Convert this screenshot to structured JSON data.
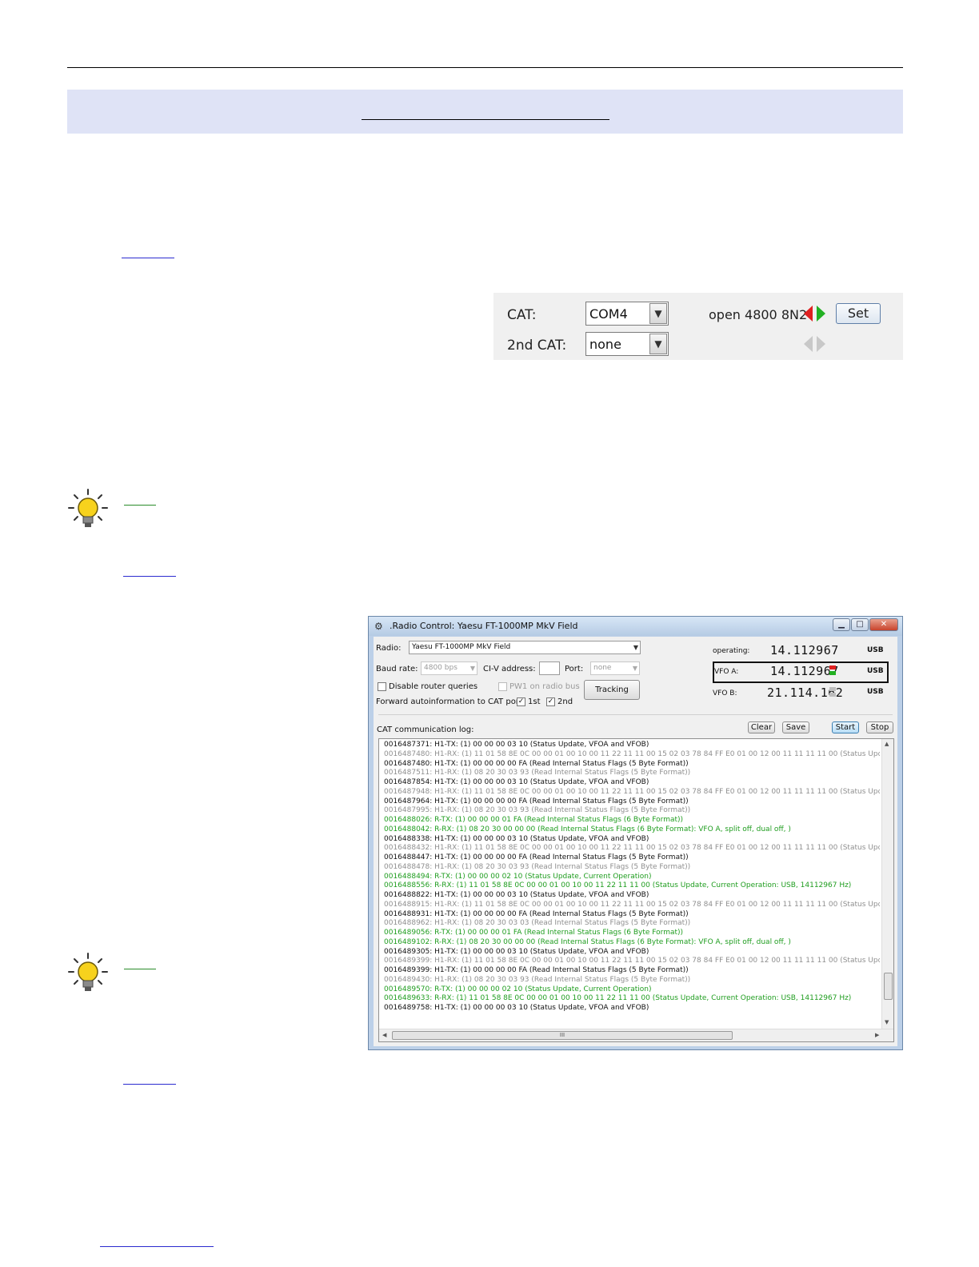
{
  "cat_panel": {
    "cat_label": "CAT:",
    "cat_port": "COM4",
    "second_cat_label": "2nd CAT:",
    "second_cat_port": "none",
    "status_text": "open 4800 8N2",
    "set_label": "Set",
    "colors": {
      "tx_indicator": "#e02020",
      "rx_indicator": "#22b022",
      "inactive_indicator": "#c8c8c8"
    }
  },
  "window": {
    "title": ".Radio Control: Yaesu FT-1000MP MkV Field",
    "radio_label": "Radio:",
    "radio_value": "Yaesu FT-1000MP MkV Field",
    "baud_label": "Baud rate:",
    "baud_value": "4800 bps",
    "civ_label": "CI-V address:",
    "civ_value": "",
    "port_label": "Port:",
    "port_value": "none",
    "disable_router_label": "Disable router queries",
    "pw1_label": "PW1 on radio bus",
    "tracking_label": "Tracking",
    "forward_label": "Forward autoinformation to CAT port:",
    "forward_1st_label": "1st",
    "forward_1st_checked": true,
    "forward_2nd_label": "2nd",
    "forward_2nd_checked": true,
    "operating_label": "operating:",
    "operating_freq": "14.112967",
    "operating_mode": "USB",
    "vfoa_label": "VFO A:",
    "vfoa_freq": "14.112967",
    "vfoa_mode": "USB",
    "vfob_label": "VFO B:",
    "vfob_freq": "21.114.162",
    "vfob_mode": "USB",
    "log_label": "CAT communication log:",
    "clear_label": "Clear",
    "save_label": "Save",
    "start_label": "Start",
    "stop_label": "Stop",
    "hscroll_grip": "III",
    "colors": {
      "tx_line": "#111111",
      "rx_line": "#8f8f8f",
      "secondary_line": "#1f9d1f"
    },
    "log": [
      {
        "kind": "tx",
        "text": "0016487371:  H1-TX: (1) 00 00 00 03 10   (Status Update, VFOA and VFOB)"
      },
      {
        "kind": "rx",
        "text": "0016487480:  H1-RX: (1) 11 01 58 8E 0C 00 00 01 00 10 00 11 22 11 11 00 15 02 03 78 84 FF E0 01 00 12 00 11 11 11 11 00   (Status Update, V"
      },
      {
        "kind": "tx",
        "text": "0016487480:  H1-TX: (1) 00 00 00 00 FA   (Read Internal Status Flags (5 Byte Format))"
      },
      {
        "kind": "rx",
        "text": "0016487511:  H1-RX: (1) 08 20 30 03 93   (Read Internal Status Flags (5 Byte Format))"
      },
      {
        "kind": "tx",
        "text": "0016487854:  H1-TX: (1) 00 00 00 03 10   (Status Update, VFOA and VFOB)"
      },
      {
        "kind": "rx",
        "text": "0016487948:  H1-RX: (1) 11 01 58 8E 0C 00 00 01 00 10 00 11 22 11 11 00 15 02 03 78 84 FF E0 01 00 12 00 11 11 11 11 00   (Status Update, V"
      },
      {
        "kind": "tx",
        "text": "0016487964:  H1-TX: (1) 00 00 00 00 FA   (Read Internal Status Flags (5 Byte Format))"
      },
      {
        "kind": "rx",
        "text": "0016487995:  H1-RX: (1) 08 20 30 03 93   (Read Internal Status Flags (5 Byte Format))"
      },
      {
        "kind": "green",
        "text": "0016488026:  R-TX: (1) 00 00 00 01 FA   (Read Internal Status Flags (6 Byte Format))"
      },
      {
        "kind": "green",
        "text": "0016488042:  R-RX: (1) 08 20 30 00 00 00   (Read Internal Status Flags (6 Byte Format): VFO A, split off, dual off, )"
      },
      {
        "kind": "tx",
        "text": "0016488338:  H1-TX: (1) 00 00 00 03 10   (Status Update, VFOA and VFOB)"
      },
      {
        "kind": "rx",
        "text": "0016488432:  H1-RX: (1) 11 01 58 8E 0C 00 00 01 00 10 00 11 22 11 11 00 15 02 03 78 84 FF E0 01 00 12 00 11 11 11 11 00   (Status Update, V"
      },
      {
        "kind": "tx",
        "text": "0016488447:  H1-TX: (1) 00 00 00 00 FA   (Read Internal Status Flags (5 Byte Format))"
      },
      {
        "kind": "rx",
        "text": "0016488478:  H1-RX: (1) 08 20 30 03 93   (Read Internal Status Flags (5 Byte Format))"
      },
      {
        "kind": "green",
        "text": "0016488494:  R-TX: (1) 00 00 00 02 10   (Status Update, Current Operation)"
      },
      {
        "kind": "green",
        "text": "0016488556:  R-RX: (1) 11 01 58 8E 0C 00 00 01 00 10 00 11 22 11 11 00   (Status Update, Current Operation: USB, 14112967 Hz)"
      },
      {
        "kind": "tx",
        "text": "0016488822:  H1-TX: (1) 00 00 00 03 10   (Status Update, VFOA and VFOB)"
      },
      {
        "kind": "rx",
        "text": "0016488915:  H1-RX: (1) 11 01 58 8E 0C 00 00 01 00 10 00 11 22 11 11 00 15 02 03 78 84 FF E0 01 00 12 00 11 11 11 11 00   (Status Update, V"
      },
      {
        "kind": "tx",
        "text": "0016488931:  H1-TX: (1) 00 00 00 00 FA   (Read Internal Status Flags (5 Byte Format))"
      },
      {
        "kind": "rx",
        "text": "0016488962:  H1-RX: (1) 08 20 30 03 03   (Read Internal Status Flags (5 Byte Format))"
      },
      {
        "kind": "green",
        "text": "0016489056:  R-TX: (1) 00 00 00 01 FA   (Read Internal Status Flags (6 Byte Format))"
      },
      {
        "kind": "green",
        "text": "0016489102:  R-RX: (1) 08 20 30 00 00 00   (Read Internal Status Flags (6 Byte Format): VFO A, split off, dual off, )"
      },
      {
        "kind": "tx",
        "text": "0016489305:  H1-TX: (1) 00 00 00 03 10   (Status Update, VFOA and VFOB)"
      },
      {
        "kind": "rx",
        "text": "0016489399:  H1-RX: (1) 11 01 58 8E 0C 00 00 01 00 10 00 11 22 11 11 00 15 02 03 78 84 FF E0 01 00 12 00 11 11 11 11 00   (Status Update, V"
      },
      {
        "kind": "tx",
        "text": "0016489399:  H1-TX: (1) 00 00 00 00 FA   (Read Internal Status Flags (5 Byte Format))"
      },
      {
        "kind": "rx",
        "text": "0016489430:  H1-RX: (1) 08 20 30 03 93   (Read Internal Status Flags (5 Byte Format))"
      },
      {
        "kind": "green",
        "text": "0016489570:  R-TX: (1) 00 00 00 02 10   (Status Update, Current Operation)"
      },
      {
        "kind": "green",
        "text": "0016489633:  R-RX: (1) 11 01 58 8E 0C 00 00 01 00 10 00 11 22 11 11 00   (Status Update, Current Operation: USB, 14112967 Hz)"
      },
      {
        "kind": "tx",
        "text": "0016489758:  H1-TX: (1) 00 00 00 03 10   (Status Update, VFOA and VFOB)"
      }
    ]
  }
}
